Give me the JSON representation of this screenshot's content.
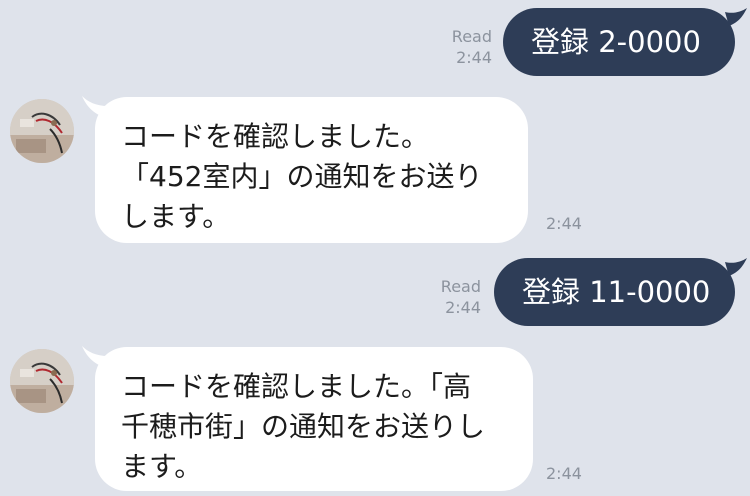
{
  "messages": [
    {
      "direction": "outgoing",
      "text": "登録 2-0000",
      "read_label": "Read",
      "time": "2:44"
    },
    {
      "direction": "incoming",
      "lines": [
        "コードを確認しました。",
        "「452室内」の通知をお送り",
        "します。"
      ],
      "time": "2:44"
    },
    {
      "direction": "outgoing",
      "text": "登録 11-0000",
      "read_label": "Read",
      "time": "2:44"
    },
    {
      "direction": "incoming",
      "lines": [
        "コードを確認しました。「高",
        "千穂市街」の通知をお送りし",
        "ます。"
      ],
      "time": "2:44"
    }
  ],
  "colors": {
    "background": "#dfe3eb",
    "outgoing_bubble": "#2e3d57",
    "incoming_bubble": "#ffffff",
    "meta_text": "#8c939e"
  },
  "icons": [
    "avatar-photo"
  ]
}
